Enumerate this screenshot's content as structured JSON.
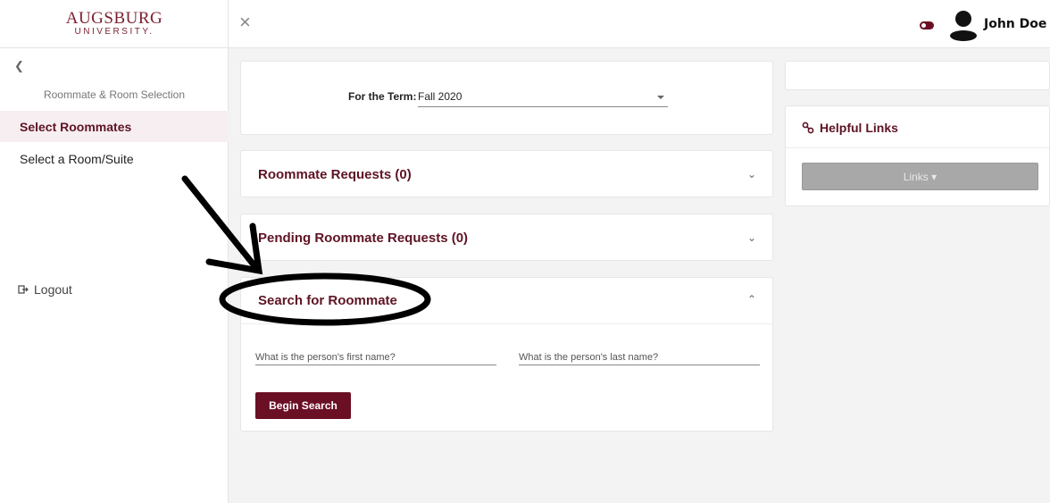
{
  "brand": {
    "logo_name": "AUGSBURG",
    "logo_sub": "UNIVERSITY."
  },
  "sidebar": {
    "section": "Roommate & Room Selection",
    "items": [
      {
        "label": "Select Roommates",
        "active": true
      },
      {
        "label": "Select a Room/Suite",
        "active": false
      }
    ],
    "logout": "Logout"
  },
  "topbar": {
    "close": "×",
    "user_name": "John Doe"
  },
  "term": {
    "label": "For the Term:",
    "value": "Fall 2020"
  },
  "accordions": {
    "roommate_requests": "Roommate Requests (0)",
    "pending_requests": "Pending Roommate Requests (0)",
    "search": "Search for Roommate"
  },
  "search": {
    "first_placeholder": "What is the person's first name?",
    "last_placeholder": "What is the person's last name?",
    "button": "Begin Search"
  },
  "links": {
    "title": "Helpful Links",
    "button": "Links"
  },
  "colors": {
    "brand": "#6b0f25",
    "accent_text": "#5e1424"
  }
}
